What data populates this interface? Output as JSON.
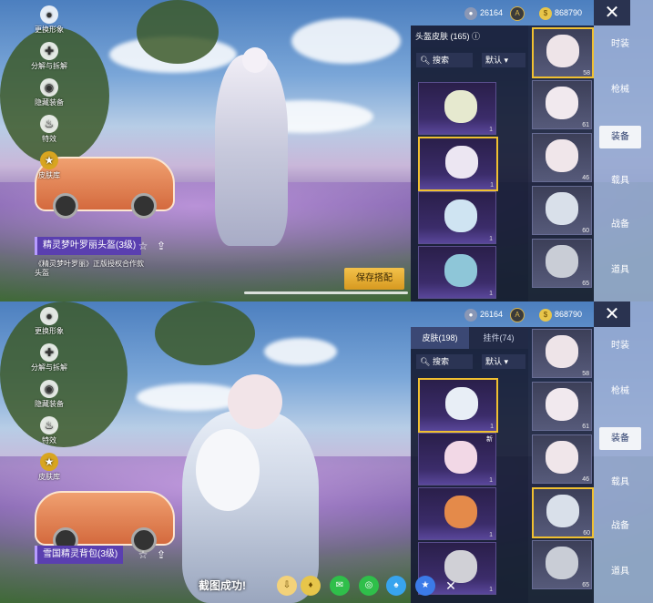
{
  "currency": {
    "silver": "26164",
    "gold": "",
    "bp": "868790"
  },
  "left_menu": [
    "更换形象",
    "分解与拆解",
    "隐藏装备",
    "特效",
    "皮肤库"
  ],
  "top": {
    "inventory_title": "头盔皮肤 (165)",
    "search_label": "搜索",
    "sort_label": "默认",
    "item_name": "精灵梦叶罗丽头盔(3级)",
    "item_desc": "《精灵梦叶罗丽》正版授权合作款头盔",
    "save_button": "保存搭配",
    "cards": [
      {
        "count": "1"
      },
      {
        "count": "1"
      },
      {
        "count": "1"
      },
      {
        "count": "1"
      }
    ]
  },
  "bottom": {
    "tab_skins": "皮肤(198)",
    "tab_pendants": "挂件(74)",
    "search_label": "搜索",
    "sort_label": "默认",
    "item_name": "雪国精灵背包(3级)",
    "new_badge": "新",
    "cards": [
      {
        "count": "1"
      },
      {
        "count": "1"
      },
      {
        "count": "1"
      },
      {
        "count": "1"
      }
    ],
    "screenshot_toast": "截图成功!"
  },
  "slot_counts": [
    "58",
    "61",
    "46",
    "60",
    "65"
  ],
  "categories": [
    "时装",
    "枪械",
    "装备",
    "载具",
    "战备",
    "道具"
  ],
  "selected_category": "装备"
}
